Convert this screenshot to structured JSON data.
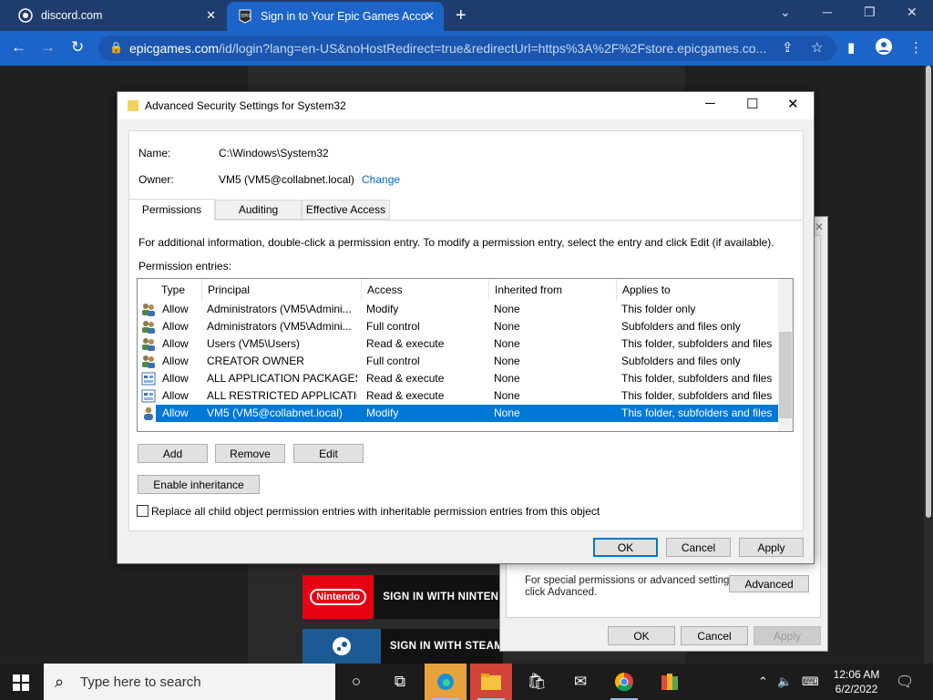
{
  "browser": {
    "tabs": [
      {
        "label": "discord.com",
        "active": false
      },
      {
        "label": "Sign in to Your Epic Games Acco",
        "active": true
      }
    ],
    "url_domain": "epicgames.com",
    "url_path": "/id/login?lang=en-US&noHostRedirect=true&redirectUrl=https%3A%2F%2Fstore.epicgames.co...",
    "new_tab": "+",
    "close_glyph": "✕"
  },
  "page": {
    "signin": [
      {
        "logo": "Nintendo",
        "label": "SIGN IN WITH NINTENDO"
      },
      {
        "logo": "",
        "label": "SIGN IN WITH STEAM"
      }
    ]
  },
  "dialog2": {
    "text_line1": "For special permissions or advanced settings,",
    "text_line2": "click Advanced.",
    "advanced": "Advanced",
    "ok": "OK",
    "cancel": "Cancel",
    "apply": "Apply"
  },
  "dialog": {
    "title": "Advanced Security Settings for System32",
    "name_label": "Name:",
    "name_value": "C:\\Windows\\System32",
    "owner_label": "Owner:",
    "owner_value": "VM5 (VM5@collabnet.local)",
    "change_link": "Change",
    "tabs": [
      "Permissions",
      "Auditing",
      "Effective Access"
    ],
    "info_text": "For additional information, double-click a permission entry. To modify a permission entry, select the entry and click Edit (if available).",
    "entries_label": "Permission entries:",
    "columns": [
      "Type",
      "Principal",
      "Access",
      "Inherited from",
      "Applies to"
    ],
    "rows": [
      {
        "type": "Allow",
        "principal": "Administrators (VM5\\Admini...",
        "access": "Modify",
        "inherited": "None",
        "applies": "This folder only",
        "icon": "users-icon"
      },
      {
        "type": "Allow",
        "principal": "Administrators (VM5\\Admini...",
        "access": "Full control",
        "inherited": "None",
        "applies": "Subfolders and files only",
        "icon": "users-icon"
      },
      {
        "type": "Allow",
        "principal": "Users (VM5\\Users)",
        "access": "Read & execute",
        "inherited": "None",
        "applies": "This folder, subfolders and files",
        "icon": "users-icon"
      },
      {
        "type": "Allow",
        "principal": "CREATOR OWNER",
        "access": "Full control",
        "inherited": "None",
        "applies": "Subfolders and files only",
        "icon": "users-icon"
      },
      {
        "type": "Allow",
        "principal": "ALL APPLICATION PACKAGES",
        "access": "Read & execute",
        "inherited": "None",
        "applies": "This folder, subfolders and files",
        "icon": "package-icon"
      },
      {
        "type": "Allow",
        "principal": "ALL RESTRICTED APPLICATIO...",
        "access": "Read & execute",
        "inherited": "None",
        "applies": "This folder, subfolders and files",
        "icon": "package-icon"
      },
      {
        "type": "Allow",
        "principal": "VM5 (VM5@collabnet.local)",
        "access": "Modify",
        "inherited": "None",
        "applies": "This folder, subfolders and files",
        "icon": "user-icon"
      }
    ],
    "selected_row": 6,
    "add": "Add",
    "remove": "Remove",
    "edit": "Edit",
    "enable_inheritance": "Enable inheritance",
    "replace_checkbox": "Replace all child object permission entries with inheritable permission entries from this object",
    "ok": "OK",
    "cancel": "Cancel",
    "apply": "Apply"
  },
  "taskbar": {
    "search_placeholder": "Type here to search",
    "time": "12:06 AM",
    "date": "6/2/2022"
  },
  "colors": {
    "selection": "#0078d7",
    "browser_tabbar": "#1f3c6e",
    "browser_toolbar": "#1c64c8",
    "link": "#0066cc"
  }
}
